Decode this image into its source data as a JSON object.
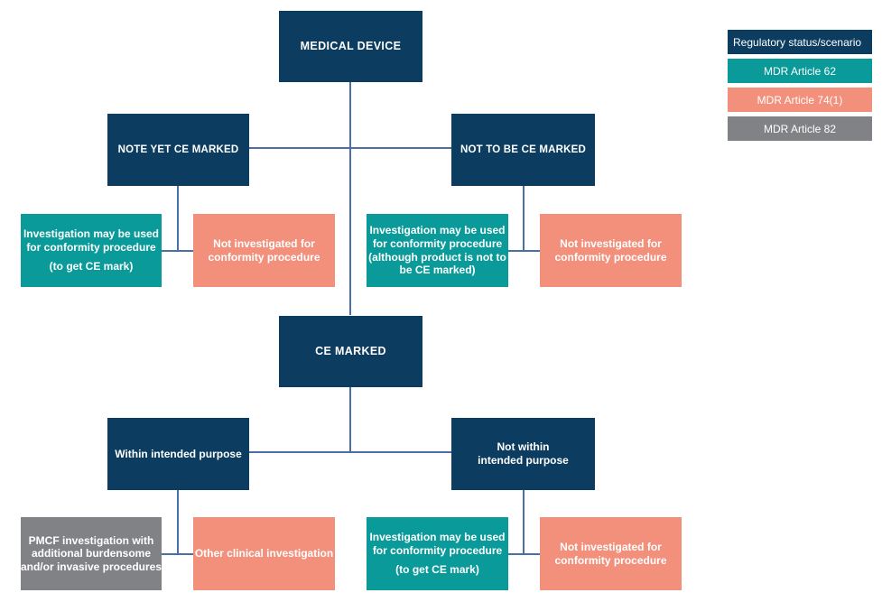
{
  "diagram": {
    "title_box": {
      "label": "MEDICAL DEVICE"
    },
    "branch_not_yet": {
      "label": "NOTE YET CE MARKED"
    },
    "branch_not_to_be": {
      "label": "NOT TO BE CE MARKED"
    },
    "leaf_a": {
      "line1": "Investigation may be used",
      "line2": "for conformity procedure",
      "line3": "(to get CE mark)"
    },
    "leaf_b": {
      "line1": "Not investigated for",
      "line2": "conformity procedure"
    },
    "leaf_c": {
      "line1": "Investigation may be used",
      "line2": "for conformity procedure",
      "line3": "(although product is not to",
      "line4": "be CE marked)"
    },
    "leaf_d": {
      "line1": "Not investigated for",
      "line2": "conformity procedure"
    },
    "ce_marked": {
      "label": "CE MARKED"
    },
    "branch_within": {
      "label": "Within intended purpose"
    },
    "branch_not_within": {
      "line1": "Not within",
      "line2": "intended purpose"
    },
    "leaf_e": {
      "line1": "PMCF investigation with",
      "line2": "additional burdensome",
      "line3": "and/or invasive procedures"
    },
    "leaf_f": {
      "line1": "Other clinical investigation"
    },
    "leaf_g": {
      "line1": "Investigation may be used",
      "line2": "for conformity procedure",
      "line3": "(to get CE mark)"
    },
    "leaf_h": {
      "line1": "Not investigated for",
      "line2": "conformity procedure"
    }
  },
  "legend": {
    "header": "Regulatory status/scenario",
    "items": [
      {
        "label": "MDR Article 62",
        "color": "#0a9a99"
      },
      {
        "label": "MDR Article 74(1)",
        "color": "#f2907c"
      },
      {
        "label": "MDR Article 82",
        "color": "#808285"
      }
    ]
  },
  "colors": {
    "navy": "#0c3c5f",
    "teal": "#0a9a99",
    "salmon": "#f2907c",
    "grey": "#808285",
    "connector": "#4a6fa5",
    "background": "#ffffff"
  }
}
